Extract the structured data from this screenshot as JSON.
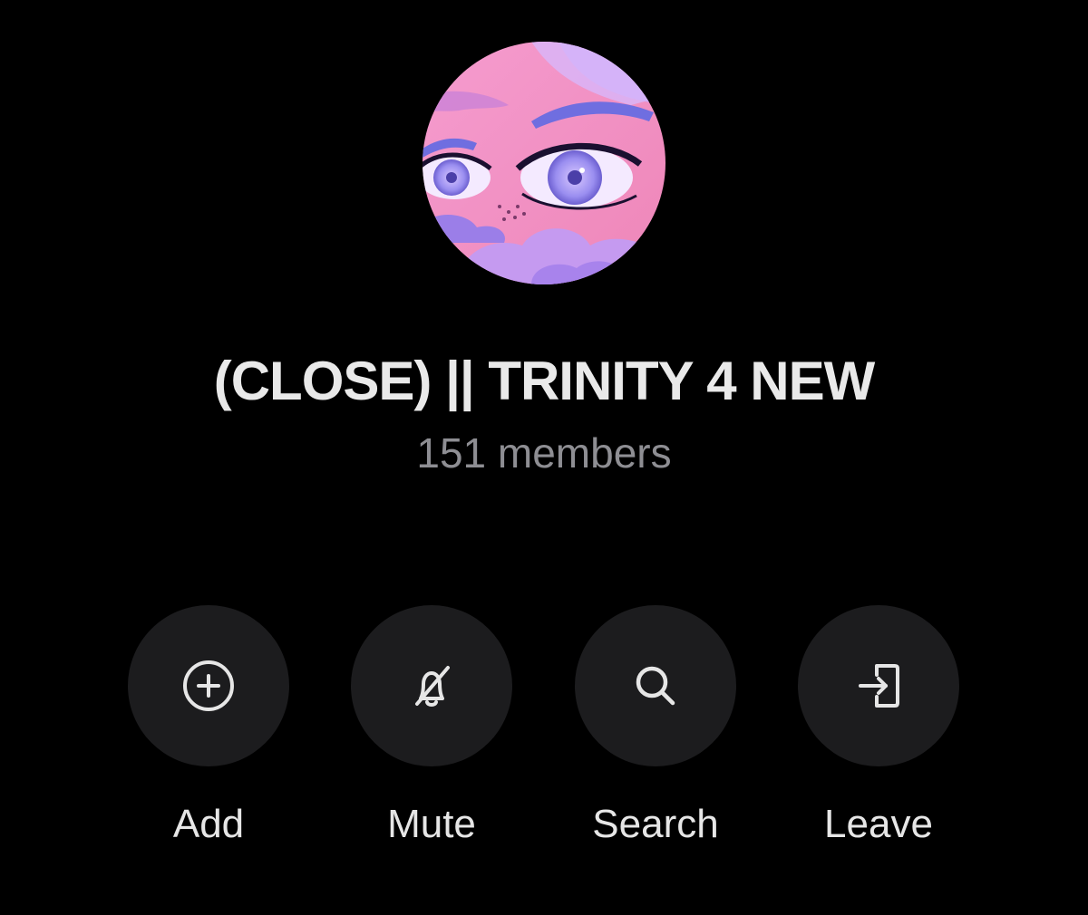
{
  "group": {
    "avatar_icon": "anime-eyes-illustration",
    "title": "(CLOSE) || TRINITY 4 NEW",
    "members": "151 members"
  },
  "actions": [
    {
      "label": "Add",
      "icon": "plus-circle-icon"
    },
    {
      "label": "Mute",
      "icon": "bell-slash-icon"
    },
    {
      "label": "Search",
      "icon": "search-icon"
    },
    {
      "label": "Leave",
      "icon": "leave-icon"
    }
  ],
  "colors": {
    "background": "#000000",
    "button_bg": "#1c1c1e",
    "title": "#e9e9e9",
    "subtitle": "#8e8e93",
    "avatar_pink": "#f08fc4",
    "avatar_purple": "#b58cf0"
  }
}
